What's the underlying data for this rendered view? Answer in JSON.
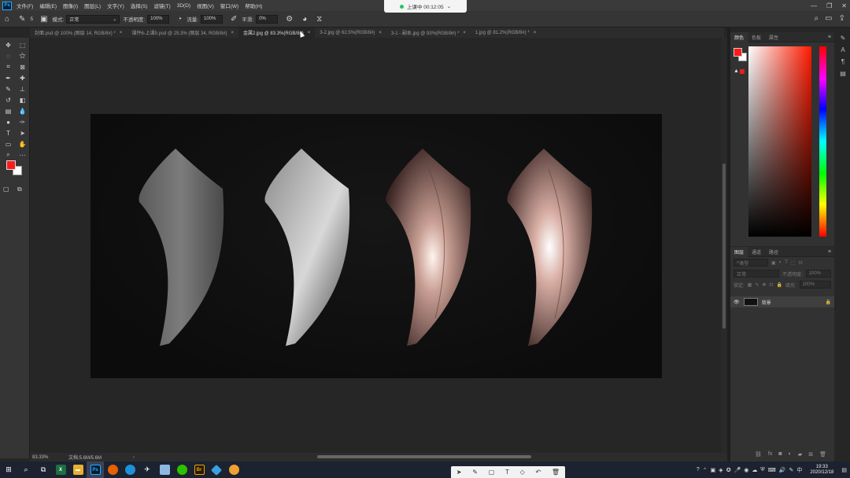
{
  "app": {
    "logo": "Ps"
  },
  "menu": [
    "文件(F)",
    "编辑(E)",
    "图像(I)",
    "图层(L)",
    "文字(Y)",
    "选择(S)",
    "滤镜(T)",
    "3D(D)",
    "视图(V)",
    "窗口(W)",
    "帮助(H)"
  ],
  "recording": {
    "label": "上课中 00:12:05"
  },
  "options": {
    "brush_size": "5",
    "mode_label": "模式:",
    "mode_value": "正常",
    "opacity_label": "不透明度:",
    "opacity_value": "100%",
    "flow_label": "流量:",
    "flow_value": "100%",
    "smooth_label": "平滑:",
    "smooth_value": "0%"
  },
  "tabs": [
    {
      "label": "封面.psd @ 100% (图层 14, RGB/8#) *",
      "active": false
    },
    {
      "label": "课件6-上课5.psd @ 25.3% (图层 34, RGB/8#)",
      "active": false
    },
    {
      "label": "金属2.jpg @ 83.3%(RGB/8#)",
      "active": true
    },
    {
      "label": "3-2.jpg @ 62.5%(RGB/8#)",
      "active": false
    },
    {
      "label": "3-1 - 副本.jpg @ 93%(RGB/8#) *",
      "active": false
    },
    {
      "label": "1.jpg @ 81.2%(RGB/8#) *",
      "active": false
    }
  ],
  "tools": [
    "move-tool",
    "marquee-tool",
    "lasso-tool",
    "magic-wand-tool",
    "crop-tool",
    "frame-tool",
    "eyedropper-tool",
    "healing-tool",
    "brush-tool",
    "stamp-tool",
    "history-brush-tool",
    "eraser-tool",
    "gradient-tool",
    "blur-tool",
    "dodge-tool",
    "pen-tool",
    "type-tool",
    "path-select-tool",
    "shape-tool",
    "hand-tool",
    "zoom-tool",
    "more-tools"
  ],
  "colors": {
    "foreground": "#ff1a1a",
    "background": "#ffffff",
    "accent": "#31a8ff"
  },
  "status": {
    "zoom": "83.33%",
    "doc": "文档:5.6M/5.6M"
  },
  "color_panel": {
    "tabs": [
      "颜色",
      "色板",
      "属性"
    ]
  },
  "layers_panel": {
    "tabs": [
      "图层",
      "通道",
      "路径"
    ],
    "filter_placeholder": "类型",
    "blend": "正常",
    "opacity_label": "不透明度:",
    "opacity_value": "100%",
    "lock_label": "锁定:",
    "fill_label": "填充:",
    "fill_value": "100%",
    "layer_name": "背景"
  },
  "taskbar": {
    "time": "19:33",
    "date": "2020/12/18",
    "ps_app": "Ps",
    "br_app": "Br"
  }
}
